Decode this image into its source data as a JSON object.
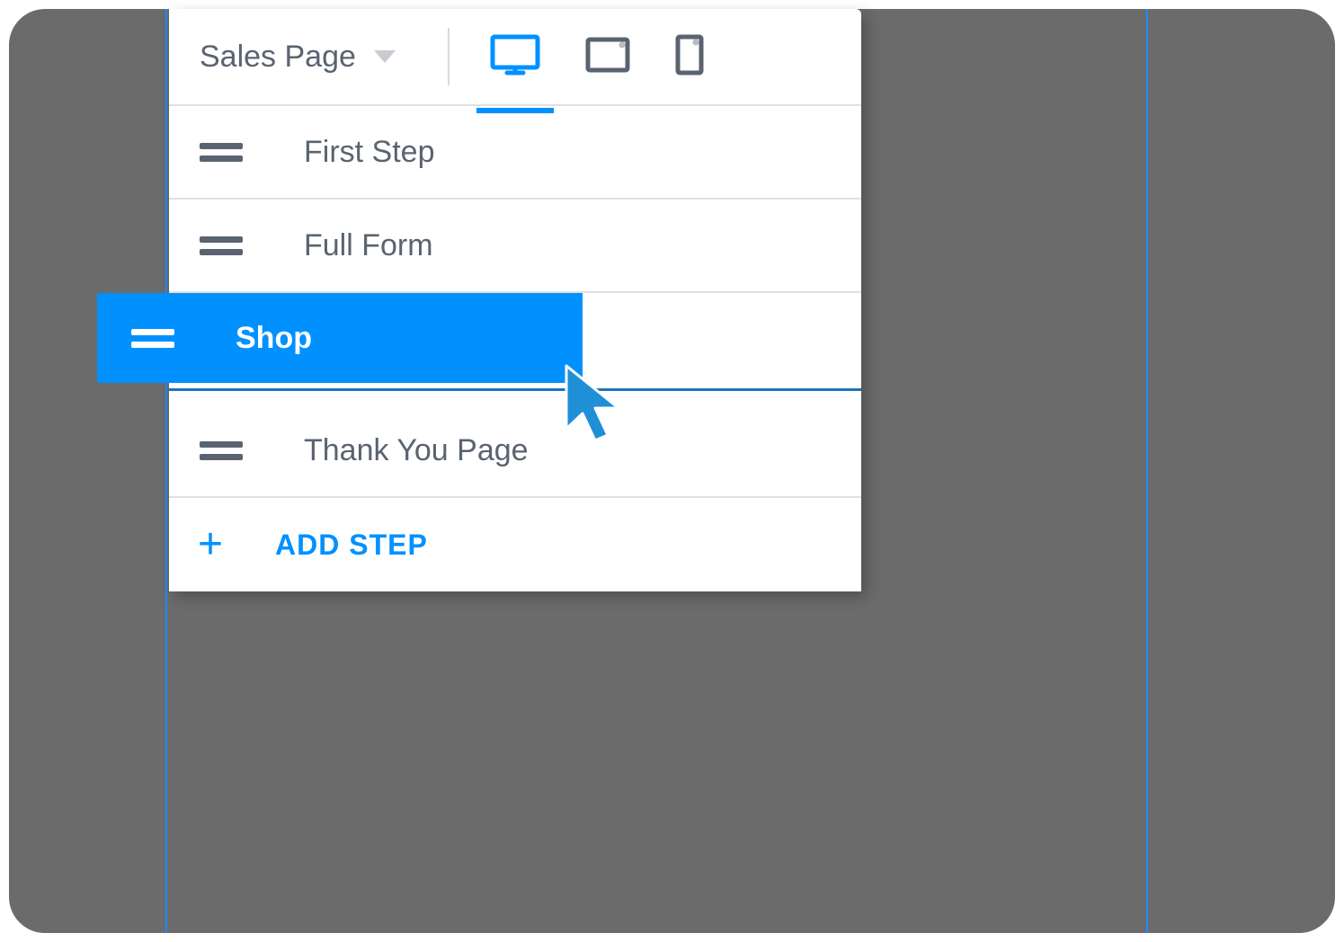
{
  "header": {
    "page_name": "Sales Page"
  },
  "devices": {
    "active": "desktop"
  },
  "steps": [
    {
      "label": "First Step",
      "state": "normal"
    },
    {
      "label": "Full Form",
      "state": "normal"
    },
    {
      "label": "Shop",
      "state": "dragging"
    },
    {
      "label": "Thank You Page",
      "state": "normal"
    }
  ],
  "add_step": {
    "label": "ADD STEP"
  },
  "colors": {
    "accent": "#0091ff",
    "text": "#5a6470",
    "canvas_bg": "#6b6b6b"
  }
}
